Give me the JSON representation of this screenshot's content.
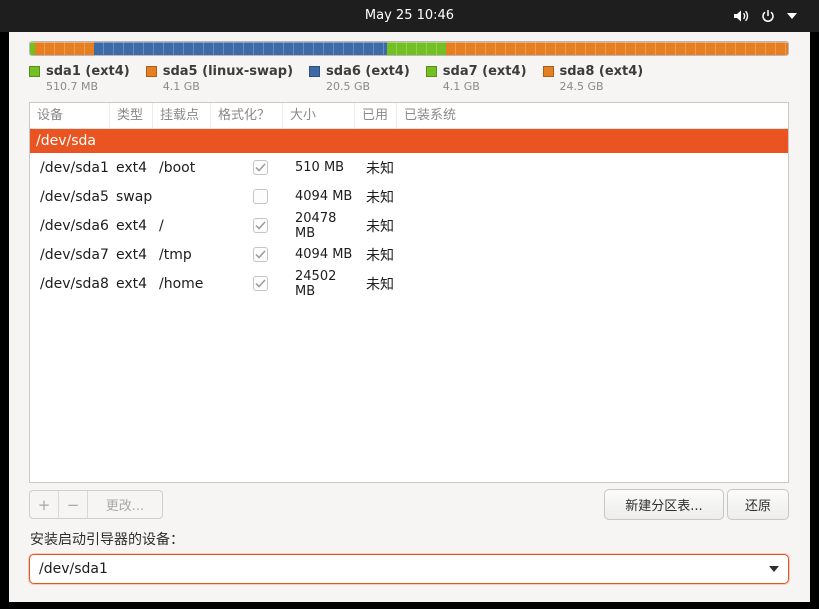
{
  "topbar": {
    "clock": "May 25  10:46",
    "icons": [
      "volume-icon",
      "power-icon",
      "menu-arrow-icon"
    ]
  },
  "partition_bar": {
    "segments": [
      {
        "name": "sda1",
        "color": "#73c025",
        "fraction": 0.0067
      },
      {
        "name": "sda5",
        "color": "#e67e22",
        "fraction": 0.0774
      },
      {
        "name": "sda6",
        "color": "#3f6aa8",
        "fraction": 0.3875
      },
      {
        "name": "sda7",
        "color": "#73c025",
        "fraction": 0.0774
      },
      {
        "name": "sda8",
        "color": "#e67e22",
        "fraction": 0.451
      }
    ]
  },
  "legend": [
    {
      "name": "sda1 (ext4)",
      "size": "510.7 MB",
      "color": "#73c025"
    },
    {
      "name": "sda5 (linux-swap)",
      "size": "4.1 GB",
      "color": "#e67e22"
    },
    {
      "name": "sda6 (ext4)",
      "size": "20.5 GB",
      "color": "#3f6aa8"
    },
    {
      "name": "sda7 (ext4)",
      "size": "4.1 GB",
      "color": "#73c025"
    },
    {
      "name": "sda8 (ext4)",
      "size": "24.5 GB",
      "color": "#e67e22"
    }
  ],
  "table": {
    "headers": [
      "设备",
      "类型",
      "挂载点",
      "格式化？",
      "大小",
      "已用",
      "已装系统"
    ],
    "disk": "/dev/sda",
    "rows": [
      {
        "device": "/dev/sda1",
        "type": "ext4",
        "mount": "/boot",
        "format": true,
        "size": "510 MB",
        "used": "未知"
      },
      {
        "device": "/dev/sda5",
        "type": "swap",
        "mount": "",
        "format": false,
        "size": "4094 MB",
        "used": "未知"
      },
      {
        "device": "/dev/sda6",
        "type": "ext4",
        "mount": "/",
        "format": true,
        "size": "20478 MB",
        "used": "未知"
      },
      {
        "device": "/dev/sda7",
        "type": "ext4",
        "mount": "/tmp",
        "format": true,
        "size": "4094 MB",
        "used": "未知"
      },
      {
        "device": "/dev/sda8",
        "type": "ext4",
        "mount": "/home",
        "format": true,
        "size": "24502 MB",
        "used": "未知"
      }
    ]
  },
  "controls": {
    "plus": "+",
    "minus": "−",
    "change": "更改...",
    "new_table": "新建分区表...",
    "revert": "还原"
  },
  "boot_loader": {
    "label": "安装启动引导器的设备：",
    "value": "/dev/sda1"
  },
  "colors": {
    "accent": "#e95420",
    "topbar": "#1e1e1e",
    "window_bg": "#f6f5f4"
  }
}
